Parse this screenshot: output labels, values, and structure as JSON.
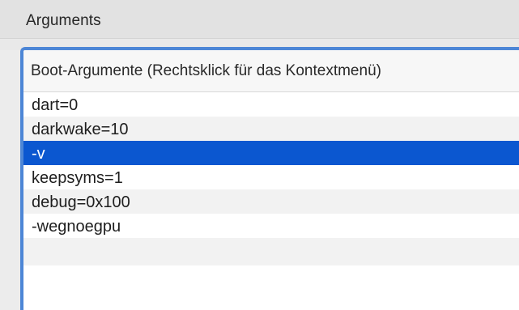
{
  "section": {
    "title": "Arguments"
  },
  "table": {
    "header": "Boot-Argumente (Rechtsklick für das Kontextmenü)",
    "rows": [
      {
        "value": "dart=0",
        "selected": false
      },
      {
        "value": "darkwake=10",
        "selected": false
      },
      {
        "value": "-v",
        "selected": true
      },
      {
        "value": "keepsyms=1",
        "selected": false
      },
      {
        "value": "debug=0x100",
        "selected": false
      },
      {
        "value": "-wegnoegpu",
        "selected": false
      }
    ]
  },
  "colors": {
    "selection": "#0b57d0",
    "focus_ring": "#4d86d6",
    "background": "#ececec"
  }
}
